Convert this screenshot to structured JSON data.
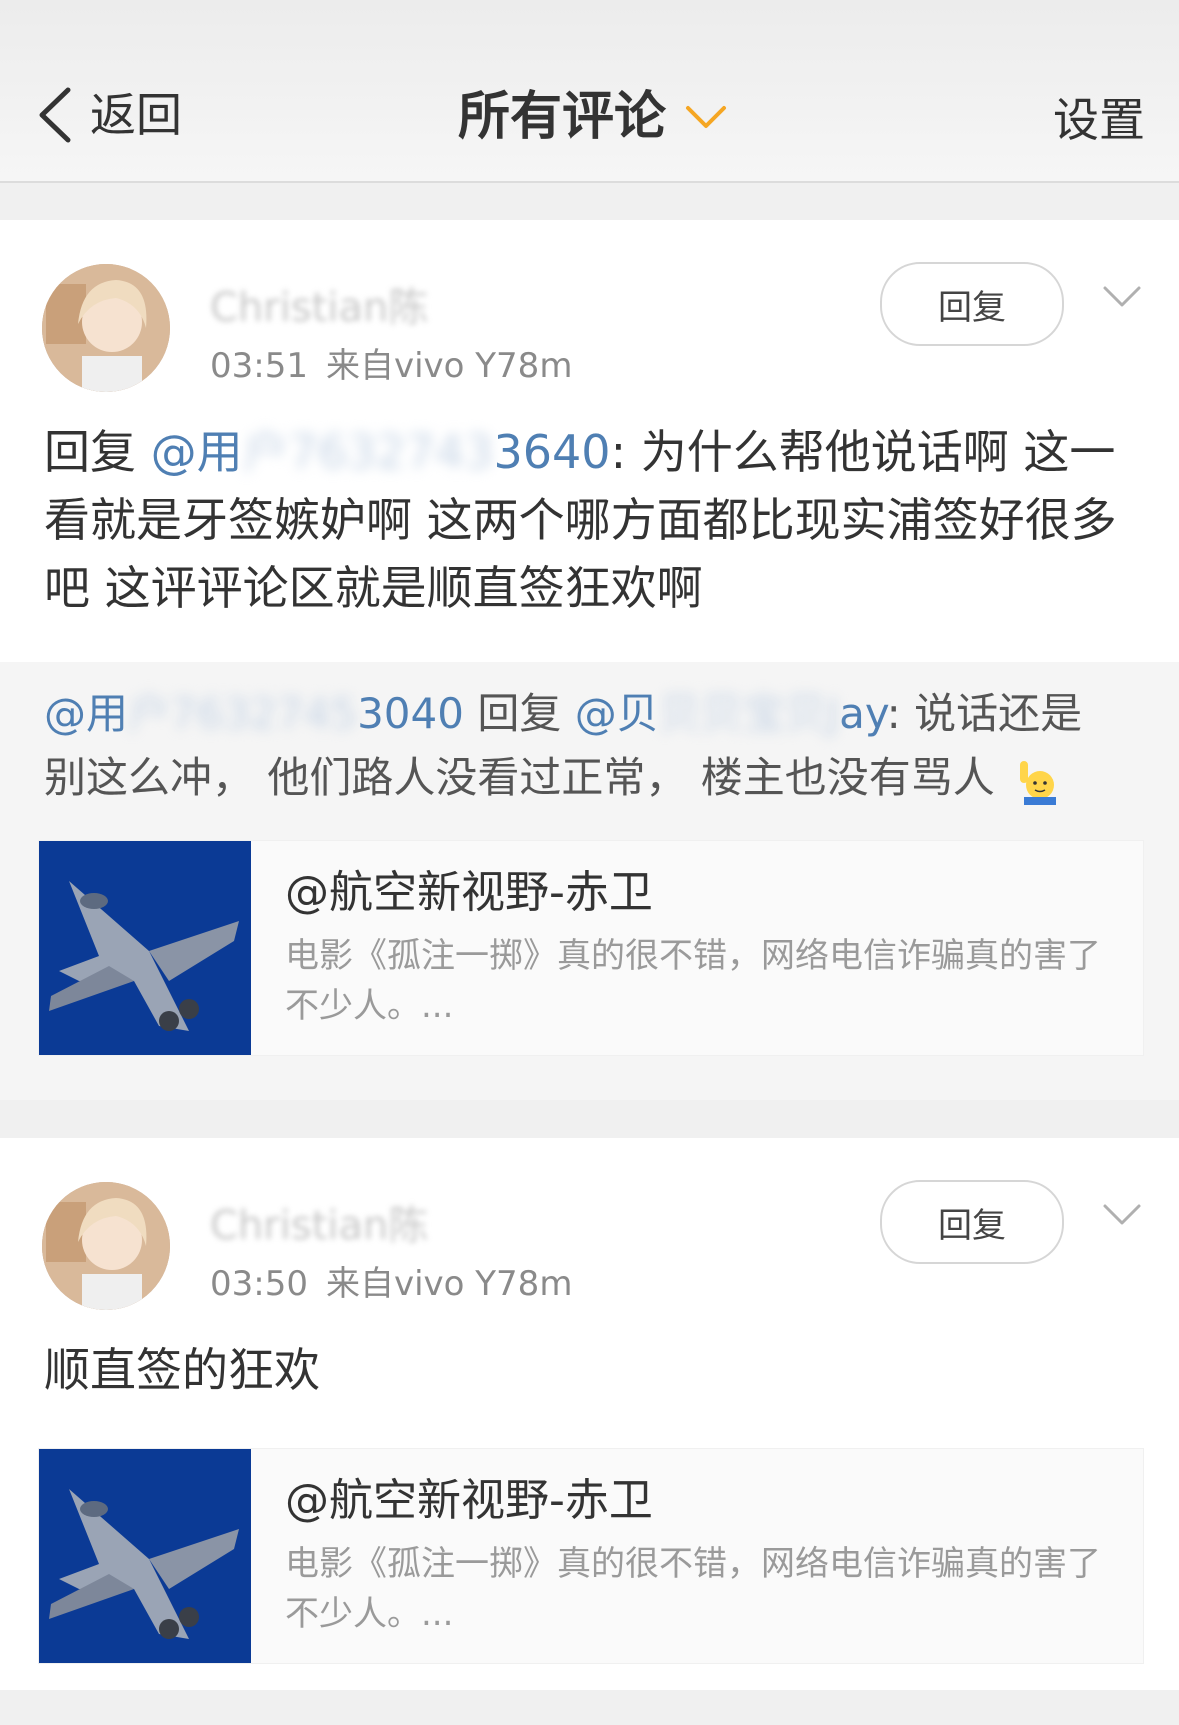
{
  "header": {
    "back_label": "返回",
    "title": "所有评论",
    "settings_label": "设置",
    "accent_color": "#f5a623"
  },
  "comments": [
    {
      "username": "Christian陈",
      "time": "03:51",
      "source": "来自vivo Y78m",
      "reply_label": "回复",
      "content": {
        "prefix": "回复",
        "mention_visible_start": "@用",
        "mention_visible_end": "3640",
        "text": ": 为什么帮他说话啊 这一看就是牙签嫉妒啊 这两个哪方面都比现实浦签好很多吧 这评评论区就是顺直签狂欢啊"
      },
      "quote": {
        "mention_a_start": "@用",
        "mention_a_end": "3040",
        "reply_word": "回复",
        "mention_b_start": "@贝",
        "mention_b_end": "ay",
        "text": ": 说话还是别这么冲， 他们路人没看过正常， 楼主也没有骂人",
        "emoji": "raising-hand-emoji"
      },
      "repost": {
        "author": "@航空新视野-赤卫",
        "snippet": "电影《孤注一掷》真的很不错，网络电信诈骗真的害了不少人。..."
      }
    },
    {
      "username": "Christian陈",
      "time": "03:50",
      "source": "来自vivo Y78m",
      "reply_label": "回复",
      "content": {
        "text": "顺直签的狂欢"
      },
      "repost": {
        "author": "@航空新视野-赤卫",
        "snippet": "电影《孤注一掷》真的很不错，网络电信诈骗真的害了不少人。..."
      }
    }
  ]
}
